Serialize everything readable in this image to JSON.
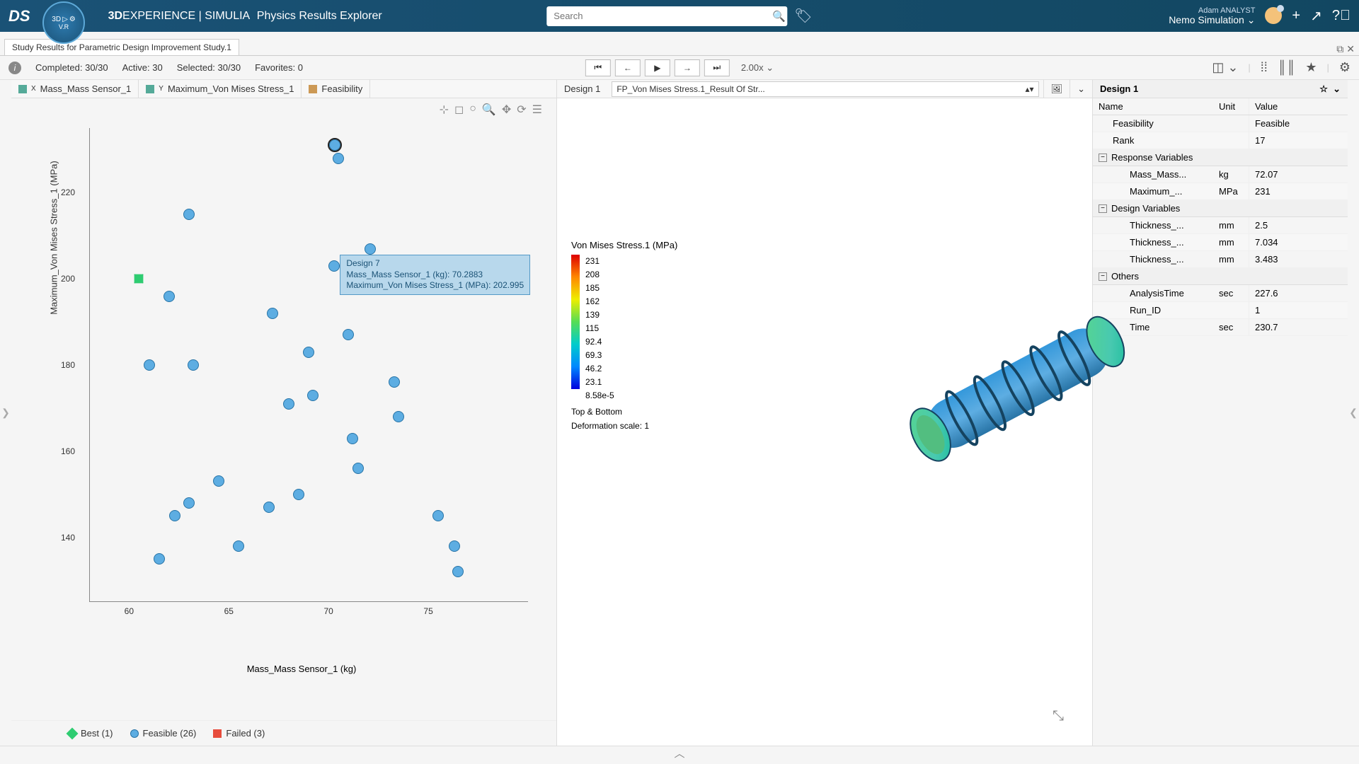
{
  "header": {
    "brand_prefix": "3D",
    "brand_main": "EXPERIENCE",
    "brand_sep": " | ",
    "brand_sub": "SIMULIA",
    "app_name": "Physics Results Explorer",
    "search_placeholder": "Search",
    "user_name": "Adam ANALYST",
    "workspace": "Nemo Simulation"
  },
  "doc_tab": "Study Results for Parametric Design Improvement Study.1",
  "status": {
    "completed": "Completed: 30/30",
    "active": "Active: 30",
    "selected": "Selected: 30/30",
    "favorites": "Favorites: 0",
    "speed": "2.00x"
  },
  "scatter": {
    "x_btn": "Mass_Mass Sensor_1",
    "y_btn": "Maximum_Von Mises Stress_1",
    "c_btn": "Feasibility",
    "x_label": "Mass_Mass Sensor_1 (kg)",
    "y_label": "Maximum_Von Mises Stress_1 (MPa)",
    "x_ticks": [
      "60",
      "65",
      "70",
      "75"
    ],
    "y_ticks": [
      "140",
      "160",
      "180",
      "200",
      "220"
    ],
    "tooltip": {
      "title": "Design 7",
      "line1": "Mass_Mass Sensor_1 (kg): 70.2883",
      "line2": "Maximum_Von Mises Stress_1 (MPa): 202.995"
    },
    "legend": {
      "best": "Best (1)",
      "feasible": "Feasible (26)",
      "failed": "Failed (3)"
    }
  },
  "viewer": {
    "tab": "Design 1",
    "selector": "FP_Von Mises Stress.1_Result Of Str...",
    "legend_title": "Von Mises Stress.1 (MPa)",
    "ticks": [
      "231",
      "208",
      "185",
      "162",
      "139",
      "115",
      "92.4",
      "69.3",
      "46.2",
      "23.1",
      "8.58e-5"
    ],
    "foot1": "Top & Bottom",
    "foot2": "Deformation scale: 1"
  },
  "props": {
    "title": "Design 1",
    "head": {
      "name": "Name",
      "unit": "Unit",
      "value": "Value"
    },
    "rows": [
      {
        "name": "Feasibility",
        "unit": "",
        "value": "Feasible",
        "indent": 1
      },
      {
        "name": "Rank",
        "unit": "",
        "value": "17",
        "indent": 1
      }
    ],
    "group_resp": "Response Variables",
    "resp": [
      {
        "name": "Mass_Mass...",
        "unit": "kg",
        "value": "72.07",
        "indent": 2
      },
      {
        "name": "Maximum_...",
        "unit": "MPa",
        "value": "231",
        "indent": 2
      }
    ],
    "group_design": "Design Variables",
    "design": [
      {
        "name": "Thickness_...",
        "unit": "mm",
        "value": "2.5",
        "indent": 2
      },
      {
        "name": "Thickness_...",
        "unit": "mm",
        "value": "7.034",
        "indent": 2
      },
      {
        "name": "Thickness_...",
        "unit": "mm",
        "value": "3.483",
        "indent": 2
      }
    ],
    "group_others": "Others",
    "others": [
      {
        "name": "AnalysisTime",
        "unit": "sec",
        "value": "227.6",
        "indent": 2
      },
      {
        "name": "Run_ID",
        "unit": "",
        "value": "1",
        "indent": 2
      },
      {
        "name": "Time",
        "unit": "sec",
        "value": "230.7",
        "indent": 2
      }
    ]
  },
  "chart_data": {
    "type": "scatter",
    "title": "",
    "xlabel": "Mass_Mass Sensor_1 (kg)",
    "ylabel": "Maximum_Von Mises Stress_1 (MPa)",
    "xlim": [
      58,
      80
    ],
    "ylim": [
      125,
      235
    ],
    "series": [
      {
        "name": "Best",
        "points": [
          {
            "x": 60.5,
            "y": 200
          }
        ]
      },
      {
        "name": "Feasible",
        "points": [
          {
            "x": 61,
            "y": 180
          },
          {
            "x": 61.5,
            "y": 135
          },
          {
            "x": 62,
            "y": 196
          },
          {
            "x": 62.3,
            "y": 145
          },
          {
            "x": 63,
            "y": 215
          },
          {
            "x": 63,
            "y": 148
          },
          {
            "x": 63.2,
            "y": 180
          },
          {
            "x": 64.5,
            "y": 153
          },
          {
            "x": 65.5,
            "y": 138
          },
          {
            "x": 67,
            "y": 147
          },
          {
            "x": 67.2,
            "y": 192
          },
          {
            "x": 68,
            "y": 171
          },
          {
            "x": 68.5,
            "y": 150
          },
          {
            "x": 69,
            "y": 183
          },
          {
            "x": 69.2,
            "y": 173
          },
          {
            "x": 70.29,
            "y": 202.99
          },
          {
            "x": 70.3,
            "y": 231
          },
          {
            "x": 70.5,
            "y": 228
          },
          {
            "x": 71,
            "y": 187
          },
          {
            "x": 71.2,
            "y": 163
          },
          {
            "x": 71.5,
            "y": 156
          },
          {
            "x": 72.1,
            "y": 207
          },
          {
            "x": 73.3,
            "y": 176
          },
          {
            "x": 73.5,
            "y": 168
          },
          {
            "x": 75.5,
            "y": 145
          },
          {
            "x": 76.3,
            "y": 138
          },
          {
            "x": 76.5,
            "y": 132
          }
        ]
      }
    ]
  }
}
